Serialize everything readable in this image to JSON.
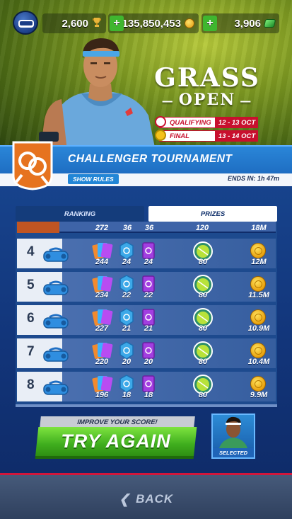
{
  "currency": {
    "trophies": "2,600",
    "coins": "135,850,453",
    "gems": "3,906"
  },
  "event": {
    "title_line1": "GRASS",
    "title_line2": "OPEN",
    "stages": [
      {
        "name": "QUALIFYING",
        "dates": "12 - 13 OCT"
      },
      {
        "name": "FINAL",
        "dates": "13 - 14 OCT"
      }
    ]
  },
  "tournament": {
    "name": "CHALLENGER TOURNAMENT",
    "show_rules": "SHOW RULES",
    "ends_in": "ENDS IN: 1h 47m"
  },
  "tabs": [
    {
      "label": "RANKING",
      "active": false
    },
    {
      "label": "PRIZES",
      "active": true
    }
  ],
  "prizes": {
    "partial_row": {
      "c1": "272",
      "c2": "36",
      "c3": "36",
      "balls": "120",
      "coins": "18M"
    },
    "rows": [
      {
        "rank": "4",
        "c1": "244",
        "c2": "24",
        "c3": "24",
        "balls": "80",
        "coins": "12M"
      },
      {
        "rank": "5",
        "c1": "234",
        "c2": "22",
        "c3": "22",
        "balls": "80",
        "coins": "11.5M"
      },
      {
        "rank": "6",
        "c1": "227",
        "c2": "21",
        "c3": "21",
        "balls": "80",
        "coins": "10.9M"
      },
      {
        "rank": "7",
        "c1": "220",
        "c2": "20",
        "c3": "20",
        "balls": "80",
        "coins": "10.4M"
      },
      {
        "rank": "8",
        "c1": "196",
        "c2": "18",
        "c3": "18",
        "balls": "80",
        "coins": "9.9M"
      }
    ]
  },
  "cta": {
    "label": "IMPROVE YOUR SCORE!",
    "button": "TRY AGAIN",
    "selected": "SELECTED"
  },
  "footer": {
    "back": "BACK"
  },
  "icons": {
    "vr": "vr-headset-icon",
    "trophy": "trophy-icon",
    "coin": "coin-icon",
    "gem": "gem-icon",
    "plus": "plus-icon",
    "bag": "equipment-bag-icon",
    "card_multi": "multicolor-card-icon",
    "card_blue": "blue-card-icon",
    "card_purple": "purple-card-icon",
    "ball": "tennis-ball-icon",
    "back": "chevron-left-icon"
  },
  "colors": {
    "accent_blue": "#1962b8",
    "stage_red": "#c8102e",
    "button_green": "#3fae1e",
    "panel_navy": "#12357a"
  }
}
